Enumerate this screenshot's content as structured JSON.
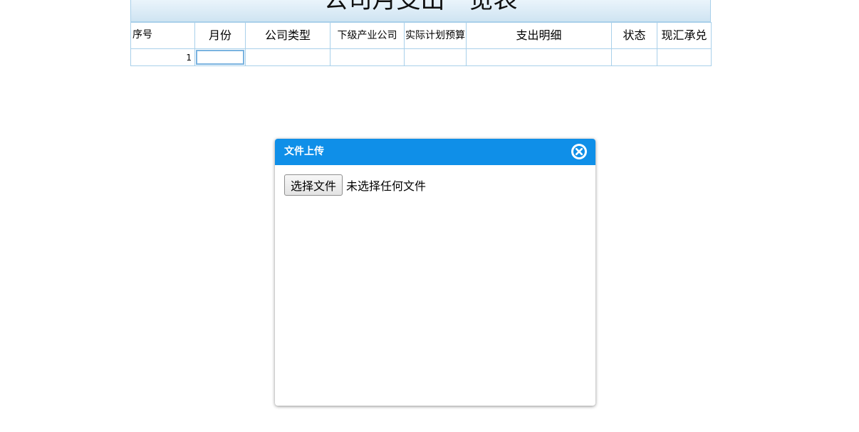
{
  "sheet": {
    "title": "公司月支出一览表",
    "columns": [
      "序号",
      "月份",
      "公司类型",
      "下级产业公司",
      "实际计划预算",
      "支出明细",
      "状态",
      "现汇承兑"
    ],
    "rows": [
      {
        "index": "1",
        "month": "",
        "company_type": "",
        "subsidiary": "",
        "budget": "",
        "detail": "",
        "status": "",
        "cash_acceptance": ""
      }
    ]
  },
  "dialog": {
    "title": "文件上传",
    "choose_file_label": "选择文件",
    "no_file_text": "未选择任何文件",
    "header_color": "#0f8fe8"
  }
}
